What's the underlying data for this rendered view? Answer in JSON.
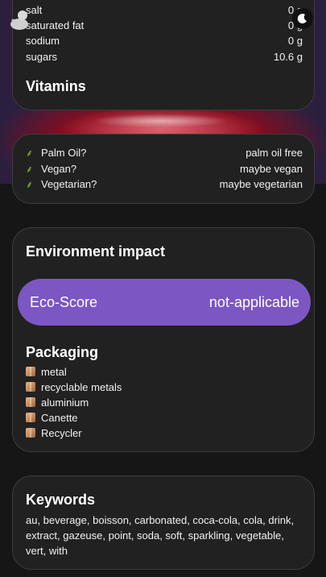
{
  "nutrition": {
    "rows": [
      {
        "label": "salt",
        "value": "0 g"
      },
      {
        "label": "saturated fat",
        "value": "0 g"
      },
      {
        "label": "sodium",
        "value": "0 g"
      },
      {
        "label": "sugars",
        "value": "10.6 g"
      }
    ],
    "vitamins_title": "Vitamins"
  },
  "labels": {
    "rows": [
      {
        "label": "Palm Oil?",
        "value": "palm oil free",
        "icon": "leaf-icon"
      },
      {
        "label": "Vegan?",
        "value": "maybe vegan",
        "icon": "leaf-icon"
      },
      {
        "label": "Vegetarian?",
        "value": "maybe vegetarian",
        "icon": "leaf-icon"
      }
    ]
  },
  "environment": {
    "title": "Environment impact",
    "ecoscore_label": "Eco-Score",
    "ecoscore_value": "not-applicable",
    "ecoscore_color": "#7c56c2",
    "packaging_title": "Packaging",
    "packaging_items": [
      "metal",
      "recyclable metals",
      "aluminium",
      "Canette",
      "Recycler"
    ]
  },
  "keywords": {
    "title": "Keywords",
    "text": "au, beverage, boisson, carbonated, coca-cola, cola, drink, extract, gazeuse, point, soda, soft, sparkling, vegetable, vert, with"
  },
  "toolbar": {
    "logo_icon": "duck-icon",
    "theme_icon": "moon-icon"
  }
}
